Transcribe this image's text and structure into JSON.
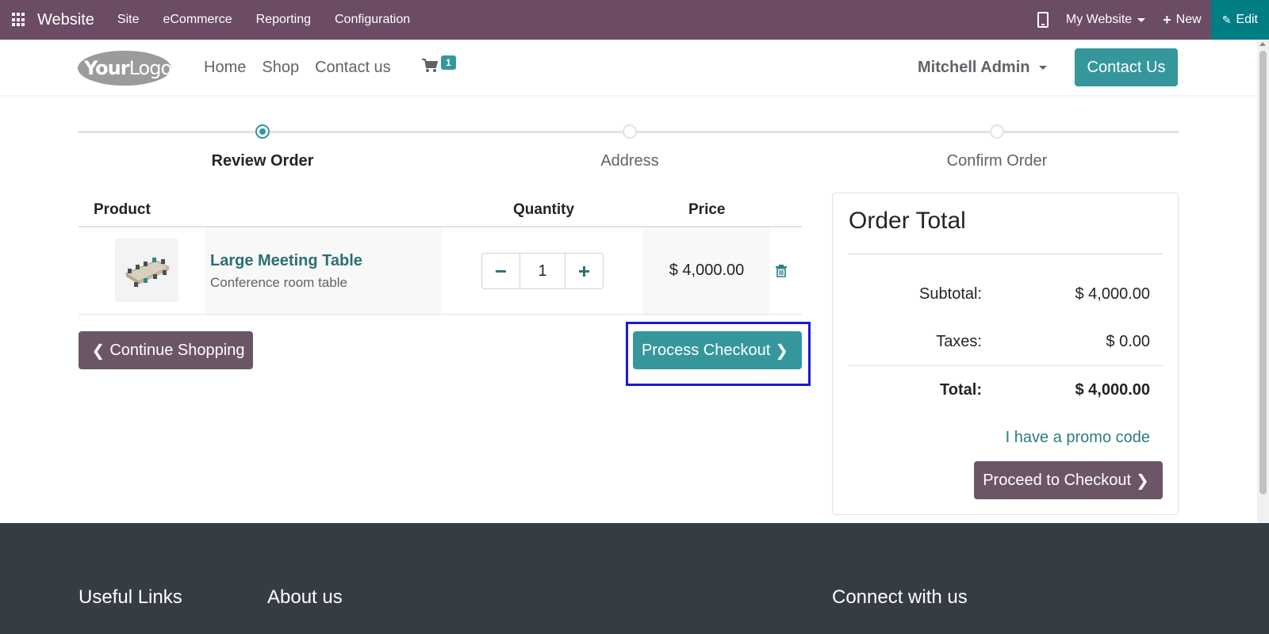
{
  "admin_bar": {
    "brand": "Website",
    "menu": [
      "Site",
      "eCommerce",
      "Reporting",
      "Configuration"
    ],
    "website_selector": "My Website",
    "new_label": "New",
    "edit_label": "Edit",
    "bg_color": "#6b4c64",
    "edit_bg_color": "#017e84"
  },
  "site_header": {
    "logo_text_bold": "Your",
    "logo_text_light": "Logo",
    "nav": [
      "Home",
      "Shop",
      "Contact us"
    ],
    "cart_count": "1",
    "user_name": "Mitchell Admin",
    "contact_button": "Contact Us"
  },
  "wizard": {
    "steps": [
      "Review Order",
      "Address",
      "Confirm Order"
    ],
    "active_step": 0
  },
  "cart_table": {
    "headers": {
      "product": "Product",
      "quantity": "Quantity",
      "price": "Price"
    },
    "rows": [
      {
        "name": "Large Meeting Table",
        "description": "Conference room table",
        "quantity": "1",
        "price": "$ 4,000.00"
      }
    ],
    "minus_icon": "minus-icon",
    "plus_icon": "plus-icon",
    "trash_icon": "trash-icon"
  },
  "buttons": {
    "continue_shopping": "Continue Shopping",
    "process_checkout": "Process Checkout"
  },
  "order_total": {
    "title": "Order Total",
    "subtotal_label": "Subtotal:",
    "subtotal_value": "$ 4,000.00",
    "taxes_label": "Taxes:",
    "taxes_value": "$ 0.00",
    "total_label": "Total:",
    "total_value": "$ 4,000.00",
    "promo_link": "I have a promo code",
    "proceed_button": "Proceed to Checkout"
  },
  "footer": {
    "headings": [
      "Useful Links",
      "About us",
      "Connect with us"
    ]
  },
  "colors": {
    "primary": "#35979c",
    "secondary": "#6b5667",
    "footer_bg": "#363c43",
    "highlight": "#1a1ad6"
  }
}
